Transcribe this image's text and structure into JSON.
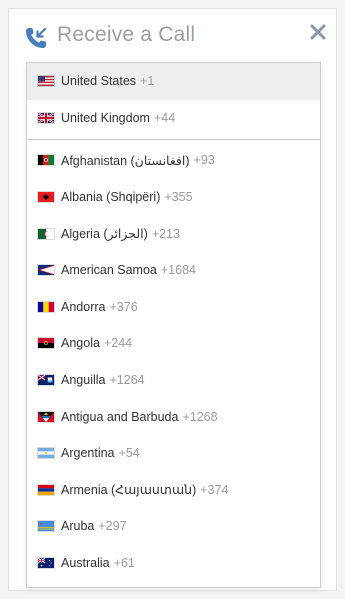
{
  "header": {
    "title": "Receive a Call",
    "phone_icon": "phone-incoming-icon",
    "close_icon": "close-icon",
    "accent": "#4a7fb8"
  },
  "dropdown": {
    "preferred": [
      {
        "name": "United States",
        "dial": "+1",
        "flag": "us",
        "selected": true
      },
      {
        "name": "United Kingdom",
        "dial": "+44",
        "flag": "gb"
      }
    ],
    "countries": [
      {
        "name": "Afghanistan (‫افغانستان‬‎)",
        "dial": "+93",
        "flag": "af"
      },
      {
        "name": "Albania (Shqipëri)",
        "dial": "+355",
        "flag": "al"
      },
      {
        "name": "Algeria (‫الجزائر‬‎)",
        "dial": "+213",
        "flag": "dz"
      },
      {
        "name": "American Samoa",
        "dial": "+1684",
        "flag": "as"
      },
      {
        "name": "Andorra",
        "dial": "+376",
        "flag": "ad"
      },
      {
        "name": "Angola",
        "dial": "+244",
        "flag": "ao"
      },
      {
        "name": "Anguilla",
        "dial": "+1264",
        "flag": "ai"
      },
      {
        "name": "Antigua and Barbuda",
        "dial": "+1268",
        "flag": "ag"
      },
      {
        "name": "Argentina",
        "dial": "+54",
        "flag": "ar"
      },
      {
        "name": "Armenia (Հայաստան)",
        "dial": "+374",
        "flag": "am"
      },
      {
        "name": "Aruba",
        "dial": "+297",
        "flag": "aw"
      },
      {
        "name": "Australia",
        "dial": "+61",
        "flag": "au"
      }
    ]
  }
}
